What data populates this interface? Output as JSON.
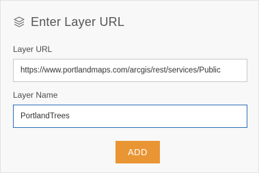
{
  "header": {
    "icon": "layers-icon",
    "title": "Enter Layer URL"
  },
  "form": {
    "url_label": "Layer URL",
    "url_value": "https://www.portlandmaps.com/arcgis/rest/services/Public",
    "name_label": "Layer Name",
    "name_value": "PortlandTrees"
  },
  "actions": {
    "add_label": "ADD"
  },
  "colors": {
    "accent": "#e99534",
    "focus_border": "#2a6fb6",
    "panel_bg": "#f8f8f8"
  }
}
